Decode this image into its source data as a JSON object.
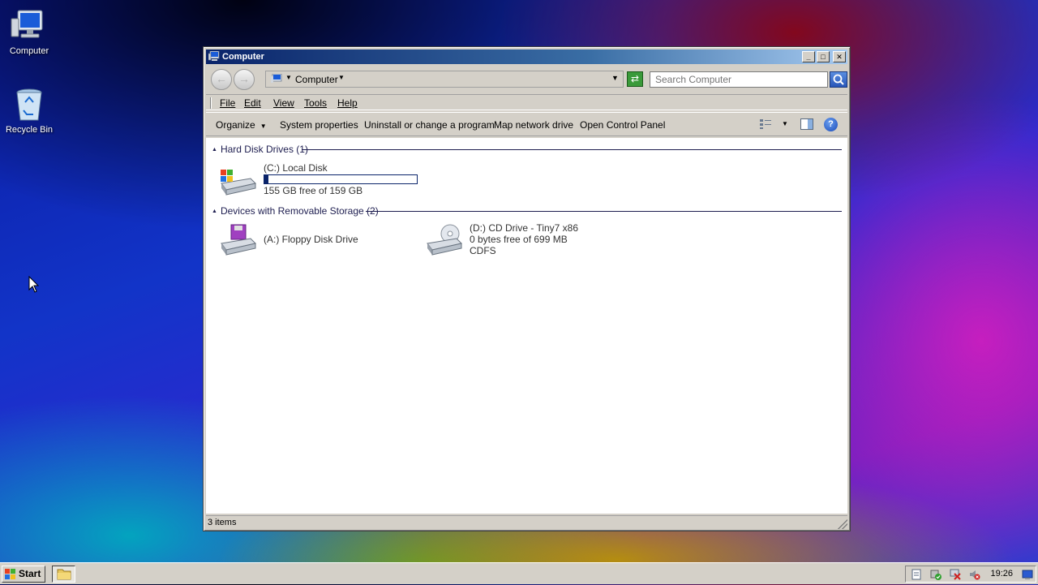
{
  "desktop": {
    "icons": [
      {
        "label": "Computer"
      },
      {
        "label": "Recycle Bin"
      }
    ]
  },
  "window": {
    "title": "Computer",
    "controls": {
      "minimize": "_",
      "maximize": "□",
      "close": "✕"
    },
    "address": {
      "crumb": "Computer",
      "search_placeholder": "Search Computer"
    },
    "menu": [
      {
        "label": "File"
      },
      {
        "label": "Edit"
      },
      {
        "label": "View"
      },
      {
        "label": "Tools"
      },
      {
        "label": "Help"
      }
    ],
    "commands": {
      "organize": "Organize",
      "system_properties": "System properties",
      "uninstall": "Uninstall or change a program",
      "map_drive": "Map network drive",
      "control_panel": "Open Control Panel"
    },
    "groups": {
      "hard_disks": {
        "header": "Hard Disk Drives (1)",
        "items": [
          {
            "name": "(C:) Local Disk",
            "free": "155 GB free of 159 GB",
            "used_fraction": 0.025
          }
        ]
      },
      "removable": {
        "header": "Devices with Removable Storage (2)",
        "items": [
          {
            "name": "(A:) Floppy Disk Drive"
          },
          {
            "name": "(D:) CD Drive - Tiny7 x86",
            "free": "0 bytes free of 699 MB",
            "fs": "CDFS"
          }
        ]
      }
    },
    "status": "3 items"
  },
  "taskbar": {
    "start_label": "Start",
    "clock": "19:26"
  },
  "colors": {
    "titlebar_start": "#0a246a",
    "titlebar_end": "#a6caf0",
    "window_face": "#d4d0c8",
    "header_text": "#1e1e50"
  }
}
